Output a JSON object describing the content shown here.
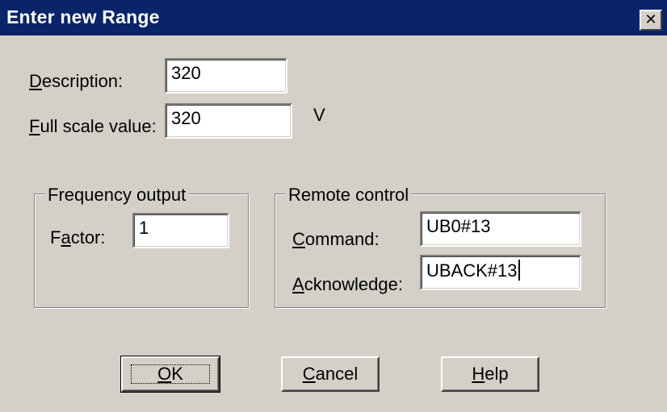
{
  "dialog": {
    "title": "Enter new Range",
    "close_glyph": "✕"
  },
  "description": {
    "label_acc": "D",
    "label_rest": "escription:",
    "value": "320"
  },
  "full_scale": {
    "label_acc": "F",
    "label_rest": "ull scale value:",
    "value": "320",
    "unit": "V"
  },
  "frequency_output": {
    "group_title": "Frequency output",
    "factor_label_pre": "F",
    "factor_label_acc": "a",
    "factor_label_rest": "ctor:",
    "factor_value": "1"
  },
  "remote_control": {
    "group_title": "Remote control",
    "command_label_acc": "C",
    "command_label_rest": "ommand:",
    "command_value": "UB0#13",
    "acknowledge_label_acc": "A",
    "acknowledge_label_rest": "cknowledge:",
    "acknowledge_value": "UBACK#13"
  },
  "buttons": {
    "ok_acc": "O",
    "ok_rest": "K",
    "cancel_acc": "C",
    "cancel_rest": "ancel",
    "help_acc": "H",
    "help_rest": "elp"
  }
}
